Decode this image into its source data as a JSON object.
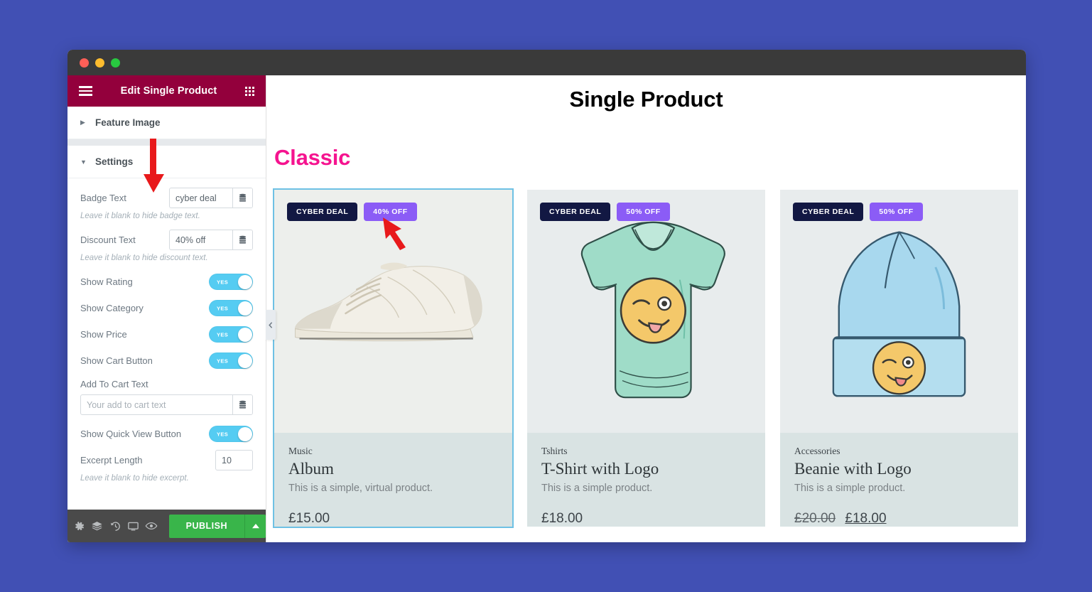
{
  "window": {
    "traffic_lights": [
      "close-red",
      "minimize-yellow",
      "maximize-green"
    ]
  },
  "panel": {
    "title": "Edit Single Product",
    "menu_icon": "hamburger-icon",
    "widgets_icon": "grid-icon",
    "sections": [
      {
        "label": "Feature Image",
        "state": "collapsed",
        "caret": "▶"
      },
      {
        "label": "Settings",
        "state": "expanded",
        "caret": "▼"
      }
    ],
    "controls": {
      "badge_text": {
        "label": "Badge Text",
        "value": "cyber deal",
        "placeholder": "",
        "hint": "Leave it blank to hide badge text."
      },
      "discount_text": {
        "label": "Discount Text",
        "value": "40% off",
        "placeholder": "",
        "hint": "Leave it blank to hide discount text."
      },
      "show_rating": {
        "label": "Show Rating",
        "value": "YES"
      },
      "show_category": {
        "label": "Show Category",
        "value": "YES"
      },
      "show_price": {
        "label": "Show Price",
        "value": "YES"
      },
      "show_cart_button": {
        "label": "Show Cart Button",
        "value": "YES"
      },
      "add_to_cart_text": {
        "label": "Add To Cart Text",
        "value": "",
        "placeholder": "Your add to cart text"
      },
      "show_quick_view_button": {
        "label": "Show Quick View Button",
        "value": "YES"
      },
      "excerpt_length": {
        "label": "Excerpt Length",
        "value": "10",
        "hint": "Leave it blank to hide excerpt."
      }
    },
    "footer": {
      "tools": [
        {
          "name": "settings-gear-icon"
        },
        {
          "name": "navigator-layers-icon"
        },
        {
          "name": "history-icon"
        },
        {
          "name": "responsive-monitor-icon"
        },
        {
          "name": "preview-eye-icon"
        }
      ],
      "publish_label": "PUBLISH",
      "publish_caret": "▲",
      "publish_color": "#39b54a"
    },
    "collapse_handle": "‹"
  },
  "preview": {
    "heading": "Single Product",
    "subheading": "Classic",
    "subheading_color": "#f5138f",
    "cards": [
      {
        "badge": "CYBER DEAL",
        "discount": "40% OFF",
        "image": "white-sneaker-photo",
        "category": "Music",
        "title": "Album",
        "description": "This is a simple, virtual product.",
        "price": "£15.00",
        "old_price": "",
        "selected": true
      },
      {
        "badge": "CYBER DEAL",
        "discount": "50% OFF",
        "image": "mint-tshirt-illustration",
        "category": "Tshirts",
        "title": "T-Shirt with Logo",
        "description": "This is a simple product.",
        "price": "£18.00",
        "old_price": "",
        "selected": false
      },
      {
        "badge": "CYBER DEAL",
        "discount": "50% OFF",
        "image": "blue-beanie-illustration",
        "category": "Accessories",
        "title": "Beanie with Logo",
        "description": "This is a simple product.",
        "price": "£18.00",
        "old_price": "£20.00",
        "selected": false
      }
    ]
  },
  "annotations": {
    "arrow_color": "#e8191b",
    "arrow_targets": [
      "badge-text-input",
      "discount-badge-on-card-1"
    ]
  }
}
